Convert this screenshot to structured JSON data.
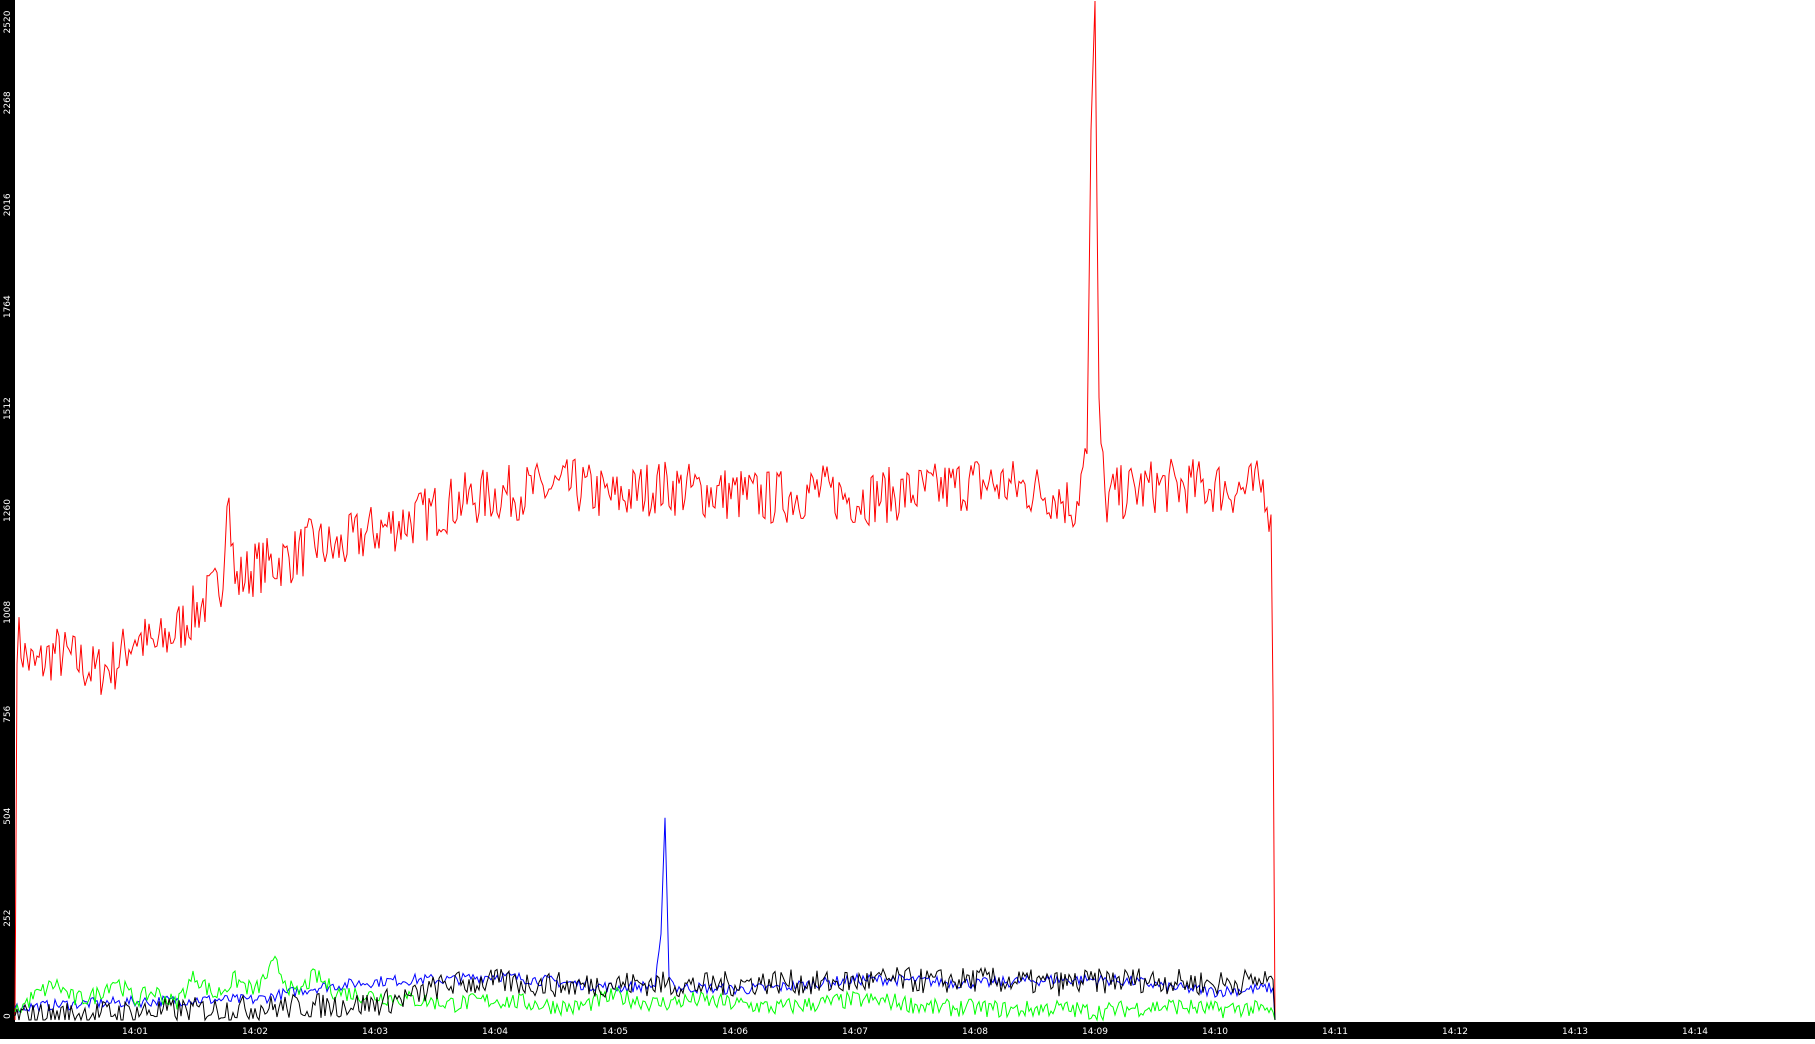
{
  "chart_data": {
    "type": "line",
    "title": "",
    "xlabel": "",
    "ylabel": "",
    "xlim": [
      "14:00:00",
      "14:14:53"
    ],
    "ylim": [
      0,
      2520
    ],
    "grid": false,
    "legend": "none",
    "y_ticks": [
      "0",
      "252",
      "504",
      "756",
      "1008",
      "1260",
      "1512",
      "1764",
      "2016",
      "2268",
      "2520"
    ],
    "x_ticks": [
      "14:01",
      "14:02",
      "14:03",
      "14:04",
      "14:05",
      "14:06",
      "14:07",
      "14:08",
      "14:09",
      "14:10",
      "14:11",
      "14:12",
      "14:13",
      "14:14"
    ],
    "colors": {
      "axis_bg": "#000000",
      "tick_text": "#ffffff",
      "background": "#ffffff"
    },
    "series": [
      {
        "color": "#ff0000",
        "x": [
          "14:00:00",
          "14:00:01",
          "14:00:05",
          "14:00:10",
          "14:00:20",
          "14:00:30",
          "14:00:40",
          "14:00:50",
          "14:01:00",
          "14:01:10",
          "14:01:20",
          "14:01:30",
          "14:01:40",
          "14:01:44",
          "14:01:46",
          "14:01:50",
          "14:02:00",
          "14:02:10",
          "14:02:20",
          "14:02:30",
          "14:02:40",
          "14:02:50",
          "14:03:00",
          "14:03:20",
          "14:03:40",
          "14:04:00",
          "14:04:20",
          "14:04:40",
          "14:05:00",
          "14:05:20",
          "14:05:40",
          "14:06:00",
          "14:06:20",
          "14:06:40",
          "14:07:00",
          "14:07:20",
          "14:07:40",
          "14:08:00",
          "14:08:20",
          "14:08:40",
          "14:08:50",
          "14:08:56",
          "14:08:58",
          "14:09:00",
          "14:09:02",
          "14:09:05",
          "14:09:10",
          "14:09:20",
          "14:09:30",
          "14:09:40",
          "14:10:00",
          "14:10:15",
          "14:10:25",
          "14:10:28",
          "14:10:29",
          "14:10:30"
        ],
        "values": [
          0,
          950,
          900,
          870,
          910,
          890,
          860,
          880,
          950,
          920,
          960,
          1010,
          1060,
          1100,
          1340,
          1080,
          1120,
          1130,
          1150,
          1180,
          1160,
          1190,
          1210,
          1240,
          1280,
          1300,
          1310,
          1320,
          1290,
          1320,
          1310,
          1300,
          1290,
          1310,
          1290,
          1300,
          1310,
          1330,
          1320,
          1300,
          1270,
          1400,
          2200,
          2520,
          1500,
          1280,
          1300,
          1310,
          1320,
          1320,
          1320,
          1310,
          1320,
          1250,
          800,
          0
        ]
      },
      {
        "color": "#0000ff",
        "x": [
          "14:00:00",
          "14:00:30",
          "14:01:00",
          "14:01:30",
          "14:02:00",
          "14:02:30",
          "14:03:00",
          "14:03:20",
          "14:03:40",
          "14:04:00",
          "14:04:20",
          "14:04:40",
          "14:05:00",
          "14:05:20",
          "14:05:23",
          "14:05:25",
          "14:05:27",
          "14:05:30",
          "14:05:40",
          "14:06:00",
          "14:06:20",
          "14:06:40",
          "14:07:00",
          "14:07:20",
          "14:07:40",
          "14:08:00",
          "14:08:20",
          "14:08:40",
          "14:09:00",
          "14:09:20",
          "14:09:40",
          "14:10:00",
          "14:10:15",
          "14:10:29",
          "14:10:30"
        ],
        "values": [
          30,
          40,
          45,
          50,
          50,
          80,
          95,
          100,
          100,
          110,
          100,
          90,
          80,
          85,
          200,
          500,
          120,
          80,
          80,
          75,
          80,
          90,
          100,
          100,
          95,
          90,
          95,
          100,
          100,
          95,
          80,
          70,
          75,
          80,
          0
        ]
      },
      {
        "color": "#00ff00",
        "x": [
          "14:00:00",
          "14:00:10",
          "14:00:20",
          "14:00:30",
          "14:00:40",
          "14:00:50",
          "14:01:00",
          "14:01:10",
          "14:01:20",
          "14:01:30",
          "14:01:40",
          "14:01:50",
          "14:02:00",
          "14:02:10",
          "14:02:20",
          "14:02:30",
          "14:02:40",
          "14:03:00",
          "14:03:20",
          "14:03:40",
          "14:04:00",
          "14:04:20",
          "14:04:40",
          "14:05:00",
          "14:05:20",
          "14:05:40",
          "14:06:00",
          "14:06:20",
          "14:06:40",
          "14:07:00",
          "14:07:20",
          "14:07:40",
          "14:08:00",
          "14:08:20",
          "14:08:40",
          "14:09:00",
          "14:09:20",
          "14:09:40",
          "14:10:00",
          "14:10:15",
          "14:10:29",
          "14:10:30"
        ],
        "values": [
          20,
          60,
          90,
          50,
          60,
          100,
          50,
          70,
          40,
          110,
          60,
          100,
          70,
          140,
          60,
          110,
          70,
          60,
          50,
          40,
          50,
          40,
          30,
          60,
          40,
          50,
          40,
          30,
          40,
          50,
          45,
          30,
          30,
          25,
          30,
          20,
          30,
          35,
          25,
          30,
          20,
          0
        ]
      },
      {
        "color": "#000000",
        "x": [
          "14:00:00",
          "14:00:30",
          "14:01:00",
          "14:01:30",
          "14:02:00",
          "14:02:30",
          "14:03:00",
          "14:03:20",
          "14:03:30",
          "14:03:40",
          "14:04:00",
          "14:04:20",
          "14:04:40",
          "14:05:00",
          "14:05:20",
          "14:05:40",
          "14:06:00",
          "14:06:20",
          "14:06:40",
          "14:07:00",
          "14:07:20",
          "14:07:40",
          "14:08:00",
          "14:08:20",
          "14:08:40",
          "14:09:00",
          "14:09:20",
          "14:09:40",
          "14:10:00",
          "14:10:15",
          "14:10:29",
          "14:10:30"
        ],
        "values": [
          10,
          15,
          20,
          25,
          30,
          35,
          40,
          60,
          80,
          90,
          95,
          90,
          85,
          90,
          90,
          85,
          90,
          95,
          90,
          95,
          100,
          95,
          100,
          95,
          90,
          95,
          100,
          95,
          90,
          95,
          100,
          0
        ]
      }
    ]
  }
}
